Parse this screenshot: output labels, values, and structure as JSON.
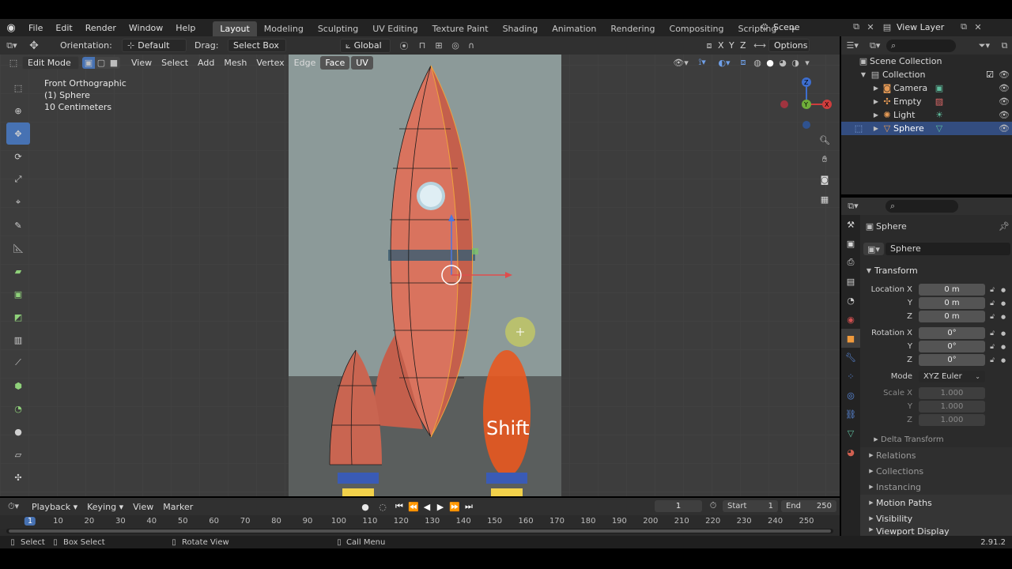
{
  "menu": {
    "items": [
      "File",
      "Edit",
      "Render",
      "Window",
      "Help"
    ],
    "workspaces": [
      "Layout",
      "Modeling",
      "Sculpting",
      "UV Editing",
      "Texture Paint",
      "Shading",
      "Animation",
      "Rendering",
      "Compositing",
      "Scripting"
    ],
    "active_workspace": "Layout",
    "add_tab": "+",
    "scene": "Scene",
    "view_layer": "View Layer"
  },
  "viewport_header": {
    "orientation_label": "Orientation:",
    "orientation_value": "Default",
    "drag_label": "Drag:",
    "drag_value": "Select Box",
    "transform_space": "Global",
    "options": "Options",
    "x": "X",
    "y": "Y",
    "z": "Z"
  },
  "mode_bar": {
    "mode": "Edit Mode",
    "view": "View",
    "select": "Select",
    "add": "Add",
    "mesh": "Mesh",
    "vertex": "Vertex",
    "edge": "Edge",
    "face": "Face",
    "uv": "UV"
  },
  "viewport_info": {
    "line1": "Front Orthographic",
    "line2": "(1) Sphere",
    "line3": "10 Centimeters"
  },
  "key_overlay": "Shift",
  "outliner": {
    "root": "Scene Collection",
    "collection": "Collection",
    "items": [
      {
        "name": "Camera",
        "selected": false
      },
      {
        "name": "Empty",
        "selected": false
      },
      {
        "name": "Light",
        "selected": false
      },
      {
        "name": "Sphere",
        "selected": true
      }
    ]
  },
  "properties": {
    "object_name": "Sphere",
    "datablock_name": "Sphere",
    "transform_title": "Transform",
    "location_label": "Location X",
    "location": {
      "x": "0 m",
      "y": "0 m",
      "z": "0 m"
    },
    "rotation_label": "Rotation X",
    "rotation": {
      "x": "0°",
      "y": "0°",
      "z": "0°"
    },
    "mode_label": "Mode",
    "mode_value": "XYZ Euler",
    "scale_label": "Scale X",
    "scale": {
      "x": "1.000",
      "y": "1.000",
      "z": "1.000"
    },
    "axis_y": "Y",
    "axis_z": "Z",
    "delta_transform": "Delta Transform",
    "panels": [
      "Relations",
      "Collections",
      "Instancing",
      "Motion Paths",
      "Visibility",
      "Viewport Display"
    ]
  },
  "timeline": {
    "playback": "Playback",
    "keying": "Keying",
    "view": "View",
    "marker": "Marker",
    "current_frame": "1",
    "start_label": "Start",
    "start_value": "1",
    "end_label": "End",
    "end_value": "250",
    "ruler": [
      "1",
      "10",
      "20",
      "30",
      "40",
      "50",
      "60",
      "70",
      "80",
      "90",
      "100",
      "110",
      "120",
      "130",
      "140",
      "150",
      "160",
      "170",
      "180",
      "190",
      "200",
      "210",
      "220",
      "230",
      "240",
      "250"
    ]
  },
  "status": {
    "select": "Select",
    "box_select": "Box Select",
    "rotate_view": "Rotate View",
    "call_menu": "Call Menu",
    "version": "2.91.2"
  },
  "colors": {
    "accent": "#4772b3",
    "selection": "#334d80",
    "rocket": "#d9735e",
    "flame": "#e8581f"
  }
}
